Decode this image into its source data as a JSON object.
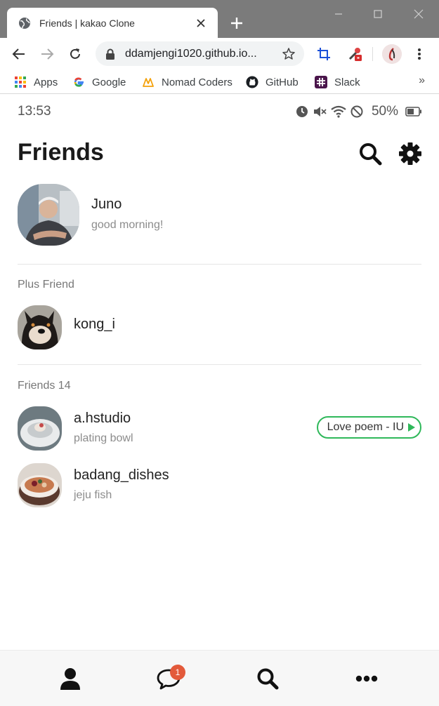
{
  "browser": {
    "tab_title": "Friends | kakao Clone",
    "url": "ddamjengi1020.github.io...",
    "bookmarks": [
      {
        "label": "Apps",
        "icon": "apps-grid-icon"
      },
      {
        "label": "Google",
        "icon": "google-icon"
      },
      {
        "label": "Nomad Coders",
        "icon": "nomad-coders-icon"
      },
      {
        "label": "GitHub",
        "icon": "github-icon"
      },
      {
        "label": "Slack",
        "icon": "slack-icon"
      }
    ],
    "more_label": "»"
  },
  "status_bar": {
    "time": "13:53",
    "battery": "50%"
  },
  "header": {
    "title": "Friends"
  },
  "my_profile": {
    "name": "Juno",
    "message": "good morning!"
  },
  "plus_friend": {
    "label": "Plus Friend",
    "items": [
      {
        "name": "kong_i"
      }
    ]
  },
  "friends": {
    "label": "Friends 14",
    "items": [
      {
        "name": "a.hstudio",
        "message": "plating bowl",
        "music": "Love poem - IU"
      },
      {
        "name": "badang_dishes",
        "message": "jeju fish"
      }
    ]
  },
  "bottom_nav": {
    "chats_badge": "1"
  },
  "colors": {
    "accent_green": "#2fb85a",
    "badge_red": "#e35a3b",
    "tabstrip": "#7b7b7b"
  }
}
